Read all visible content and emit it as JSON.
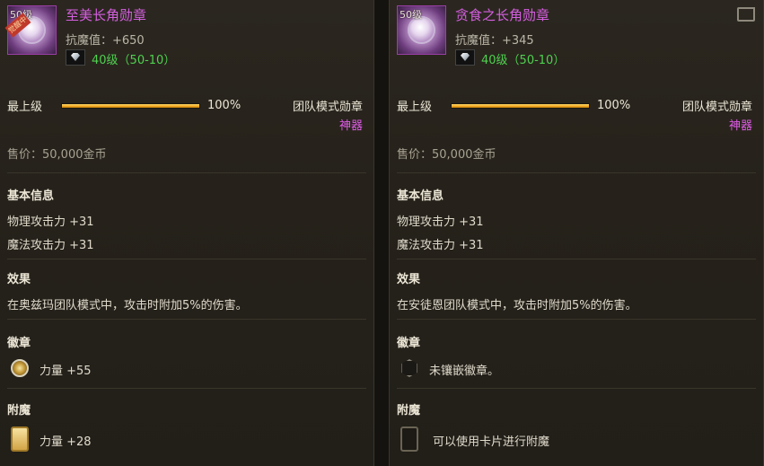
{
  "left": {
    "level_tag": "50级",
    "ribbon": "觉醒中",
    "name": "至美长角勋章",
    "anti_magic": "抗魔值：+650",
    "level_range": "40级（50-10）",
    "top_label": "最上级",
    "progress_pct": 100,
    "progress_text": "100%",
    "mode": "团队模式勋章",
    "artifact": "神器",
    "price": "售价：50,000金币",
    "basic_title": "基本信息",
    "phys_attack": "物理攻击力 +31",
    "magic_attack": "魔法攻击力 +31",
    "effect_title": "效果",
    "effect_text": "在奥兹玛团队模式中，攻击时附加5%的伤害。",
    "emblem_title": "徽章",
    "emblem_text": "力量 +55",
    "emblem_icon": "gold-emblem-icon",
    "enchant_title": "附魔",
    "enchant_text": "力量 +28",
    "enchant_icon": "gold-card-icon"
  },
  "right": {
    "level_tag": "50级",
    "name": "贪食之长角勋章",
    "anti_magic": "抗魔值：+345",
    "level_range": "40级（50-10）",
    "top_label": "最上级",
    "progress_pct": 100,
    "progress_text": "100%",
    "mode": "团队模式勋章",
    "artifact": "神器",
    "price": "售价：50,000金币",
    "basic_title": "基本信息",
    "phys_attack": "物理攻击力 +31",
    "magic_attack": "魔法攻击力 +31",
    "effect_title": "效果",
    "effect_text": "在安徒恩团队模式中，攻击时附加5%的伤害。",
    "emblem_title": "徽章",
    "emblem_text": "未镶嵌徽章。",
    "emblem_icon": "empty-emblem-socket-icon",
    "enchant_title": "附魔",
    "enchant_text": "可以使用卡片进行附魔",
    "enchant_icon": "empty-card-slot-icon"
  },
  "colors": {
    "name": "#d55fe0",
    "level_green": "#4fd04f",
    "progress": "#f0a820",
    "artifact": "#e05ce8"
  }
}
